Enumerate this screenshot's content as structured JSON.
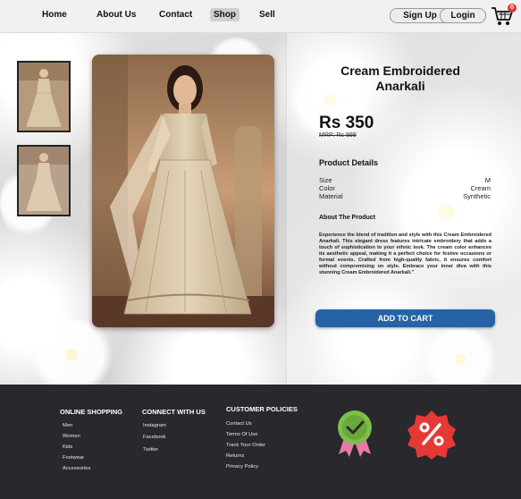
{
  "header": {
    "nav": [
      "Home",
      "About Us",
      "Contact",
      "Shop",
      "Sell"
    ],
    "active_nav": "Shop",
    "signup_label": "Sign Up",
    "login_label": "Login",
    "cart_count": "0"
  },
  "product": {
    "title": "Cream Embroidered Anarkali",
    "price": "Rs 350",
    "mrp": "MRP: Rs 999",
    "details_heading": "Product Details",
    "details": [
      {
        "label": "Size",
        "value": "M"
      },
      {
        "label": "Color",
        "value": "Cream"
      },
      {
        "label": "Material",
        "value": "Synthetic"
      }
    ],
    "about_heading": "About The Product",
    "about_text": "Experience the blend of tradition and style with this Cream Embroidered Anarkali. This elegant dress features intricate embroidery that adds a touch of sophistication to your ethnic look. The cream color enhances its aesthetic appeal, making it a perfect choice for festive occasions or formal events. Crafted from high-quality fabric, it ensures comfort without compromising on style. Embrace your inner diva with this stunning Cream Embroidered Anarkali.\"",
    "add_to_cart_label": "ADD TO CART"
  },
  "footer": {
    "columns": [
      {
        "heading": "ONLINE SHOPPING",
        "links": [
          "Men",
          "Women",
          "Kids",
          "Footwear",
          "Accessories"
        ]
      },
      {
        "heading": "CONNECT WITH US",
        "links": [
          "Instagram",
          "Facebook",
          "Twitter"
        ]
      },
      {
        "heading": "CUSTOMER POLICIES",
        "links": [
          "Contact Us",
          "Terms Of Use",
          "Track Your Order",
          "Returns",
          "Privacy Policy"
        ]
      }
    ]
  },
  "colors": {
    "accent_button": "#2563a6",
    "footer_bg": "#29282d",
    "badge_green": "#7cbf4b",
    "badge_red": "#e53935"
  }
}
